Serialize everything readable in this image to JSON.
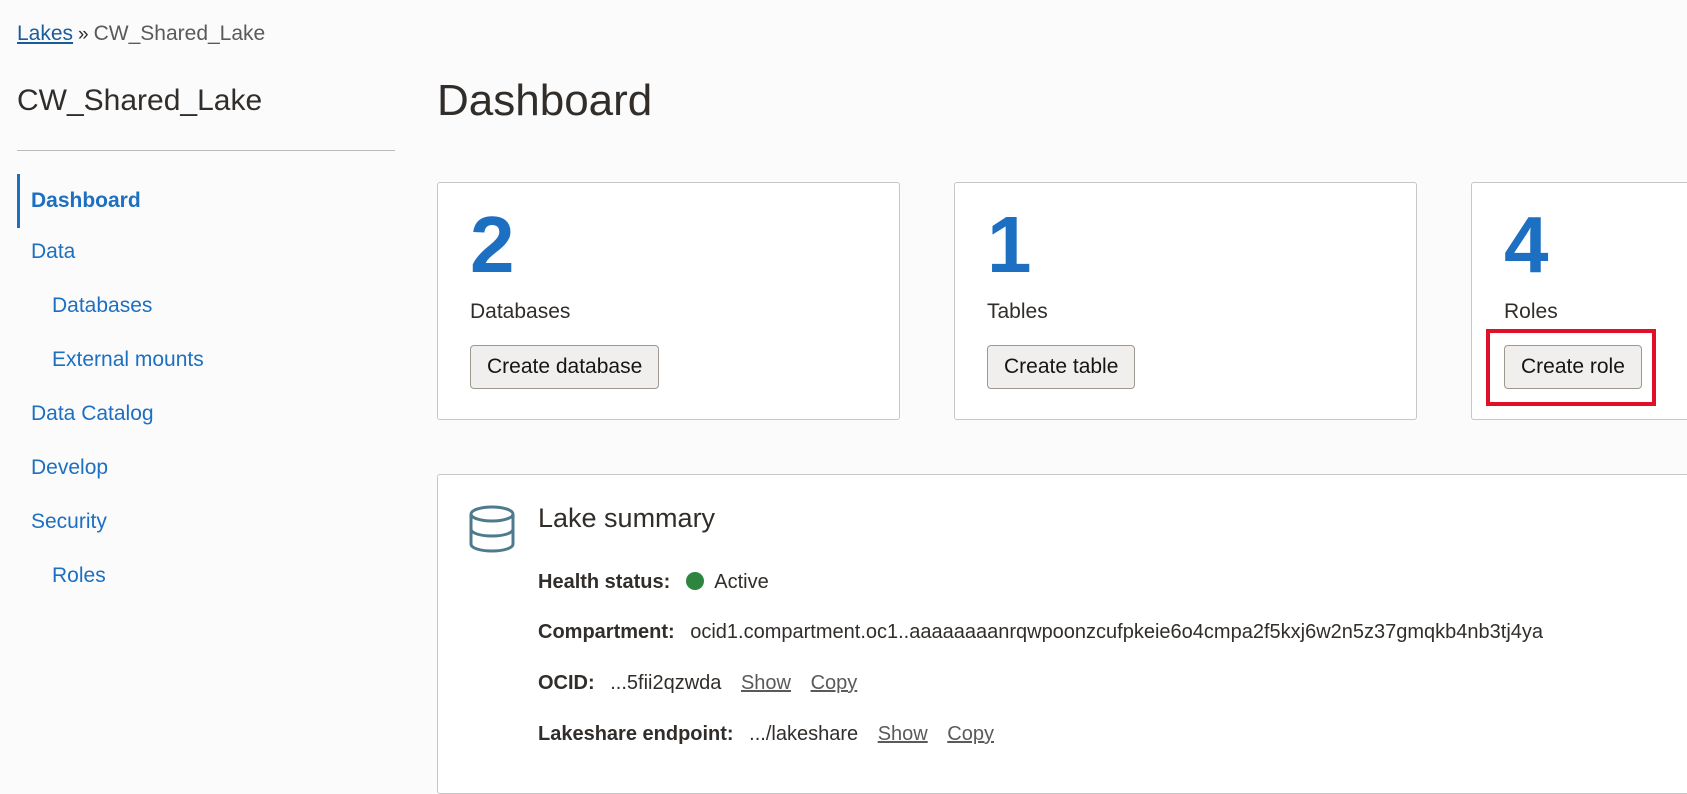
{
  "breadcrumb": {
    "root": "Lakes",
    "separator": "»",
    "current": "CW_Shared_Lake"
  },
  "sidebar": {
    "title": "CW_Shared_Lake",
    "items": [
      {
        "label": "Dashboard"
      },
      {
        "label": "Data"
      },
      {
        "label": "Databases"
      },
      {
        "label": "External mounts"
      },
      {
        "label": "Data Catalog"
      },
      {
        "label": "Develop"
      },
      {
        "label": "Security"
      },
      {
        "label": "Roles"
      }
    ]
  },
  "main": {
    "title": "Dashboard",
    "cards": [
      {
        "count": "2",
        "label": "Databases",
        "button": "Create database"
      },
      {
        "count": "1",
        "label": "Tables",
        "button": "Create table"
      },
      {
        "count": "4",
        "label": "Roles",
        "button": "Create role"
      }
    ],
    "summary": {
      "title": "Lake summary",
      "health_label": "Health status:",
      "health_value": "Active",
      "compartment_label": "Compartment:",
      "compartment_value": "ocid1.compartment.oc1..aaaaaaaanrqwpoonzcufpkeie6o4cmpa2f5kxj6w2n5z37gmqkb4nb3tj4ya",
      "ocid_label": "OCID:",
      "ocid_value": "...5fii2qzwda",
      "endpoint_label": "Lakeshare endpoint:",
      "endpoint_value": ".../lakeshare",
      "show_label": "Show",
      "copy_label": "Copy"
    }
  },
  "colors": {
    "accent": "#1c6fc1",
    "active_status": "#2e8540",
    "highlight": "#e0102a"
  }
}
